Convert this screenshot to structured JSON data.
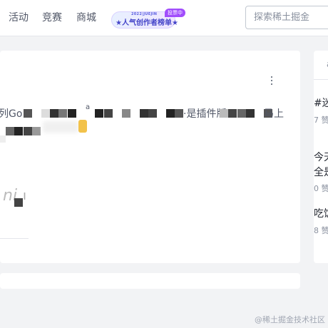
{
  "nav": {
    "items": [
      "活动",
      "竞赛",
      "商城"
    ]
  },
  "banner": {
    "year_text": "2022|JUEJIN",
    "title": "★人气创作者榜单★",
    "tag": "投票中"
  },
  "search": {
    "placeholder": "探索稀土掘金"
  },
  "article": {
    "fragments": [
      "列Go",
      "a",
      "·是插件版",
      "马上",
      "ni",
      "ı"
    ]
  },
  "sidebar": {
    "header": "a",
    "items": [
      {
        "title": "#迷",
        "meta": "7 赞"
      },
      {
        "title": "今天",
        "title2": "全是",
        "meta": "0 赞"
      },
      {
        "title": "吃饭",
        "meta": "8 赞"
      }
    ]
  },
  "watermark": "@稀土掘金技术社区",
  "colors": {
    "brand_purple": "#a14dfc",
    "banner_blue": "#4545c9",
    "text_gray": "#515767",
    "bg": "#f2f3f5"
  }
}
